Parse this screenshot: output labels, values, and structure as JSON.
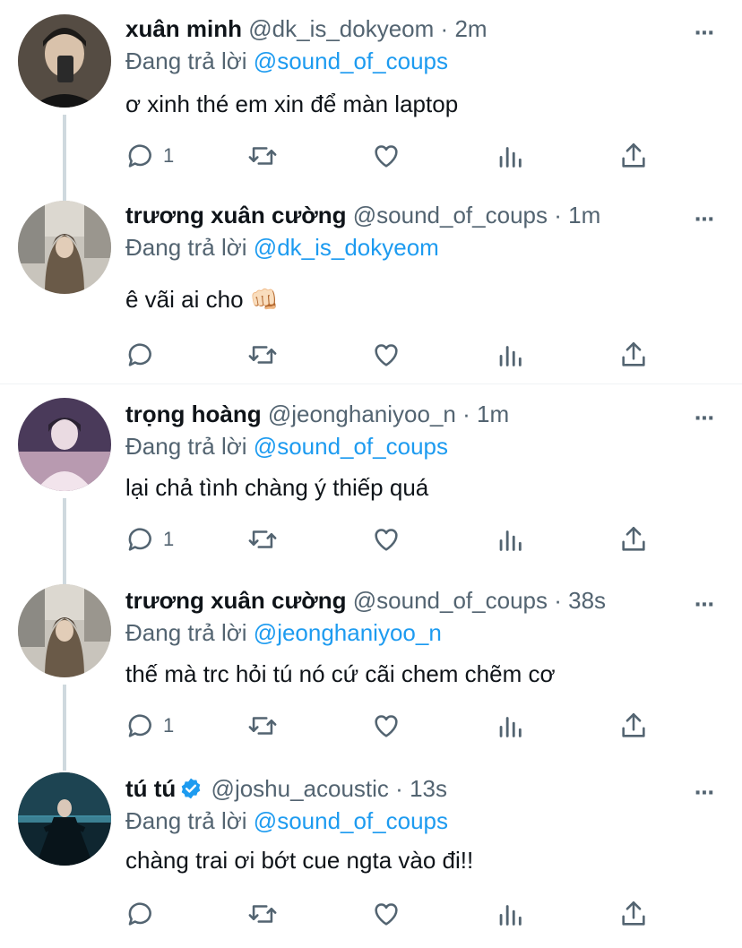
{
  "reply_prefix": "Đang trả lời",
  "more_icon": "⋯",
  "tweets": [
    {
      "name": "xuân minh",
      "handle": "@dk_is_dokyeom",
      "time": "2m",
      "reply_to": "@sound_of_coups",
      "text": "ơ xinh thé em xin để màn laptop",
      "reply_count": "1"
    },
    {
      "name": "trương xuân cường",
      "handle": "@sound_of_coups",
      "time": "1m",
      "reply_to": "@dk_is_dokyeom",
      "text": "ê vãi ai cho 👊🏻",
      "reply_count": ""
    },
    {
      "name": "trọng hoàng",
      "handle": "@jeonghaniyoo_n",
      "time": "1m",
      "reply_to": "@sound_of_coups",
      "text": "lại chả tình chàng ý thiếp quá",
      "reply_count": "1"
    },
    {
      "name": "trương xuân cường",
      "handle": "@sound_of_coups",
      "time": "38s",
      "reply_to": "@jeonghaniyoo_n",
      "text": "thế mà trc hỏi tú nó cứ cãi chem chẽm cơ",
      "reply_count": "1"
    },
    {
      "name": "tú tú",
      "handle": "@joshu_acoustic",
      "time": "13s",
      "reply_to": "@sound_of_coups",
      "text": "chàng trai ơi bớt cue ngta vào đi!!",
      "reply_count": "",
      "verified": true
    }
  ],
  "colors": {
    "mention": "#1d9bf0",
    "secondary_text": "#536471",
    "verified_badge": "#1d9bf0",
    "thread_line": "#cfd9de"
  },
  "icons": [
    "reply-icon",
    "retweet-icon",
    "like-icon",
    "analytics-icon",
    "share-icon",
    "more-icon",
    "verified-badge-icon"
  ]
}
